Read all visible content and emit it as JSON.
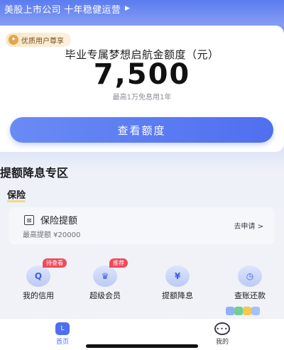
{
  "banner": {
    "text": "美股上市公司  十年稳健运营",
    "arrow_icon": "play-triangle-icon"
  },
  "quota_card": {
    "vip_badge": "优质用户尊享",
    "title": "毕业专属梦想启航金额度（元）",
    "amount": "7,500",
    "note": "最高1万免息用1年",
    "button_label": "查看额度"
  },
  "section": {
    "title": "提额降息专区",
    "category": "保险"
  },
  "insurance_card": {
    "icon_glyph": "⊠",
    "name": "保险提额",
    "limit": "最高提额 ¥20000",
    "apply_label": "去申请 >"
  },
  "quick_actions": [
    {
      "label": "我的信用",
      "tag": "待查看",
      "icon": "credit-shield-icon",
      "glyph": "Q"
    },
    {
      "label": "超级会员",
      "tag": "推荐",
      "icon": "member-crown-icon",
      "glyph": "♛"
    },
    {
      "label": "提额降息",
      "tag": "",
      "icon": "yen-coin-icon",
      "glyph": "¥"
    },
    {
      "label": "查账还款",
      "tag": "",
      "icon": "bill-clock-icon",
      "glyph": "◷"
    }
  ],
  "bottom_nav": {
    "home_label": "首页",
    "mine_label": "我的",
    "active": "home"
  },
  "colors": {
    "accent": "#4f6ff0",
    "tag_red": "#f04a5a",
    "badge_gold": "#e2a54a"
  }
}
